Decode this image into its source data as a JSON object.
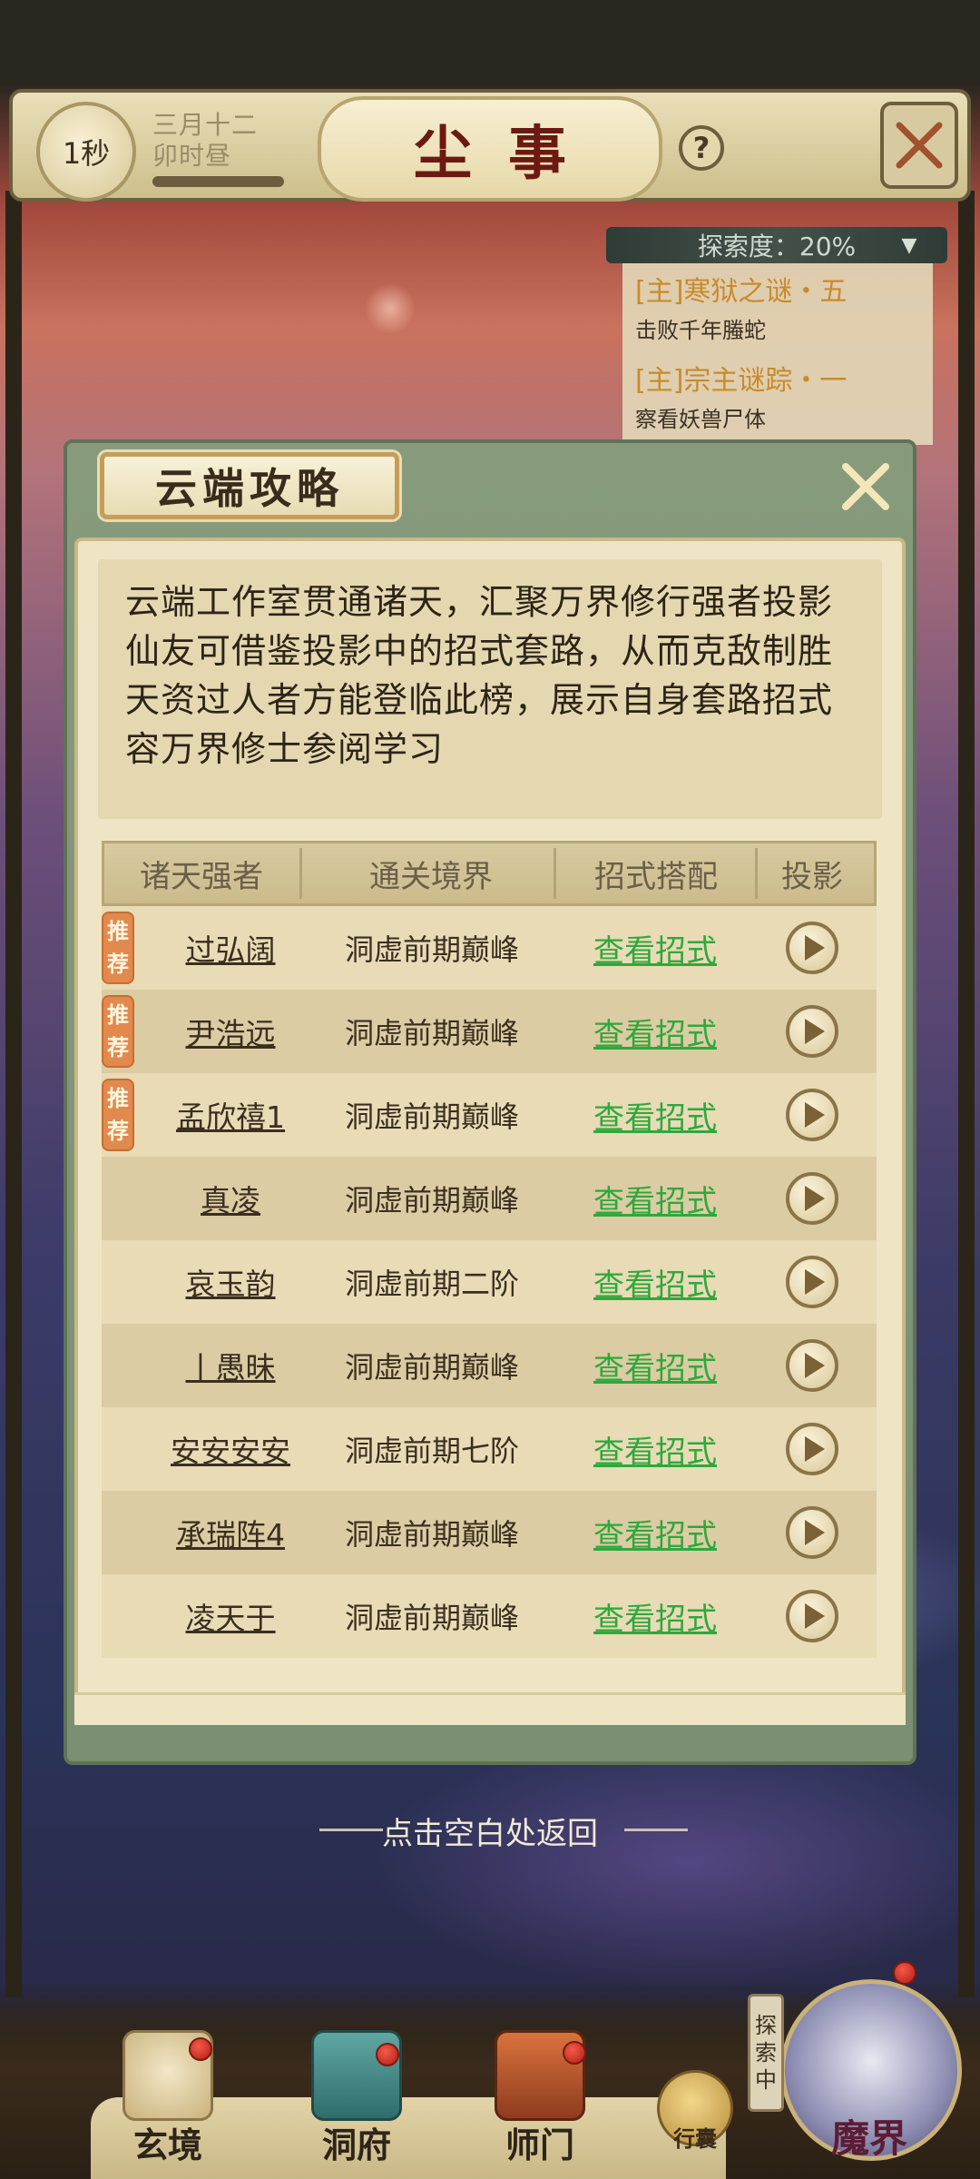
{
  "hud": {
    "timer": "1秒",
    "date_line1": "三月十二",
    "date_line2": "卯时昼",
    "title": "尘事",
    "help": "?"
  },
  "quest": {
    "explore": "探索度：20%",
    "items": [
      {
        "title": "[主]寒狱之谜・五",
        "desc": "击败千年螣蛇"
      },
      {
        "title": "[主]宗主谜踪・一",
        "desc": "察看妖兽尸体"
      }
    ]
  },
  "dialog": {
    "title": "云端攻略",
    "description": [
      "云端工作室贯通诸天，汇聚万界修行强者投影",
      "仙友可借鉴投影中的招式套路，从而克敌制胜",
      "天资过人者方能登临此榜，展示自身套路招式",
      "容万界修士参阅学习"
    ],
    "columns": [
      "诸天强者",
      "通关境界",
      "招式搭配",
      "投影"
    ],
    "recommend_top": "推",
    "recommend_bottom": "荐",
    "link_label": "查看招式",
    "rows": [
      {
        "name": "过弘阔",
        "realm": "洞虚前期巅峰",
        "recommended": true
      },
      {
        "name": "尹浩远",
        "realm": "洞虚前期巅峰",
        "recommended": true
      },
      {
        "name": "孟欣禧1",
        "realm": "洞虚前期巅峰",
        "recommended": true
      },
      {
        "name": "真凌",
        "realm": "洞虚前期巅峰",
        "recommended": false
      },
      {
        "name": "哀玉韵",
        "realm": "洞虚前期二阶",
        "recommended": false
      },
      {
        "name": "丨愚昧",
        "realm": "洞虚前期巅峰",
        "recommended": false
      },
      {
        "name": "安安安安",
        "realm": "洞虚前期七阶",
        "recommended": false
      },
      {
        "name": "承瑞阵4",
        "realm": "洞虚前期巅峰",
        "recommended": false
      },
      {
        "name": "凌天于",
        "realm": "洞虚前期巅峰",
        "recommended": false
      }
    ]
  },
  "return_hint": "点击空白处返回",
  "nav": {
    "items": [
      "玄境",
      "洞府",
      "师门"
    ],
    "bag": "行囊",
    "explore_tag": [
      "探",
      "索",
      "中"
    ],
    "demon": "魔界"
  },
  "colors": {
    "link": "#2fa83c",
    "recommend_badge": "#e28a4e",
    "title_red": "#6b1a12",
    "quest_gold": "#c88b2c"
  }
}
